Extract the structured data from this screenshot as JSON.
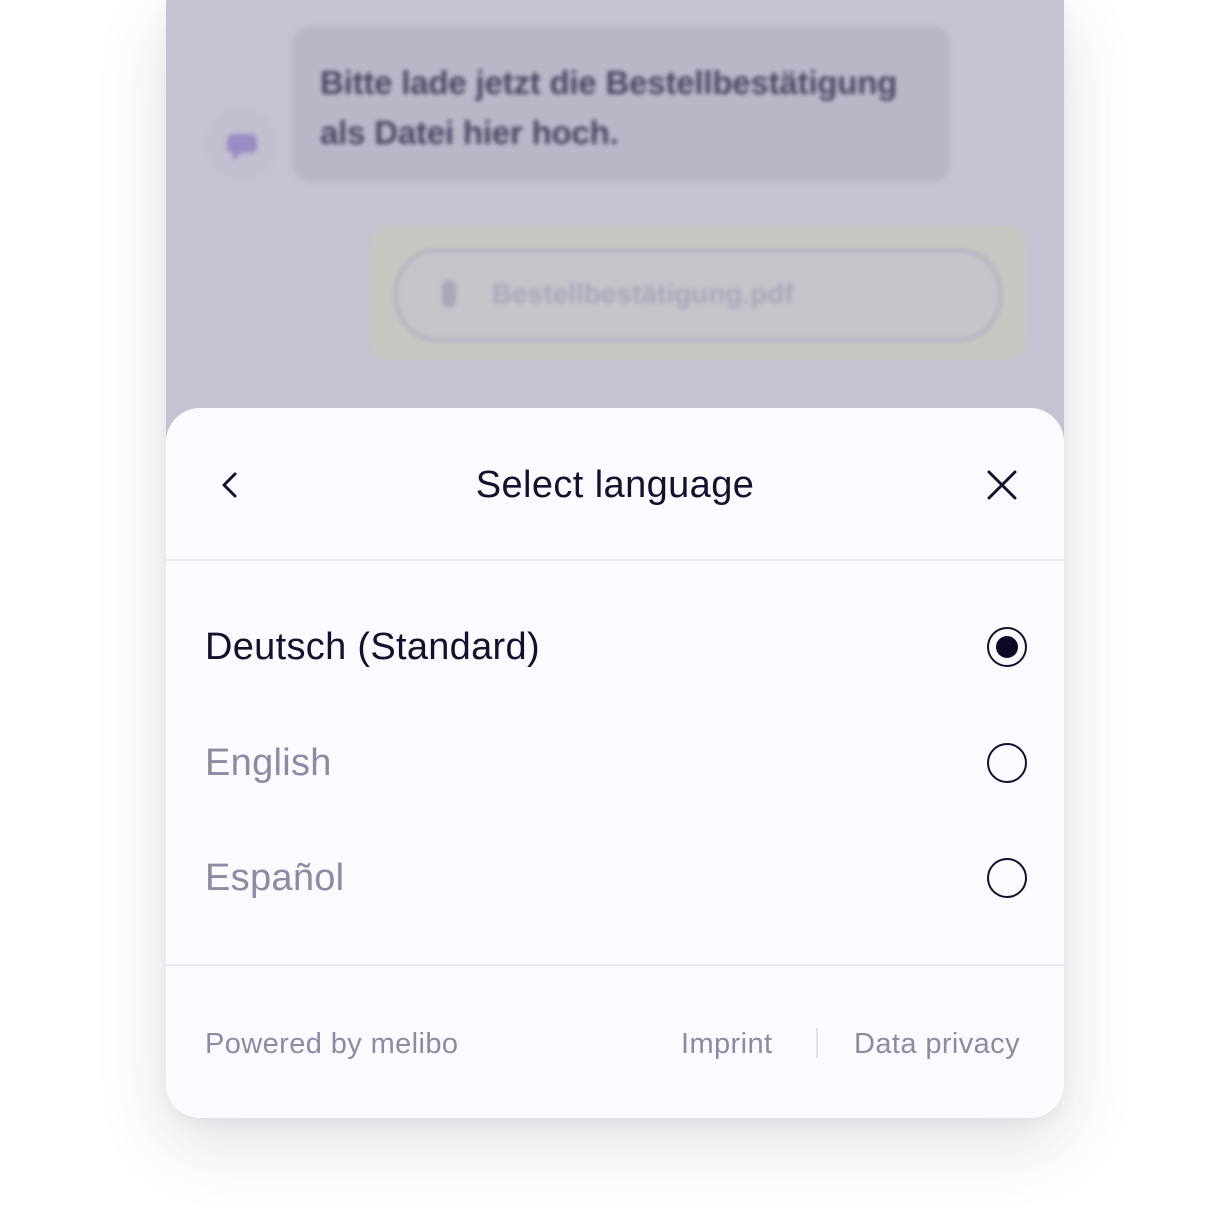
{
  "chat": {
    "bot_message": "Bitte lade jetzt die Bestellbestätigung als Datei hier hoch.",
    "uploaded_file": "Bestellbestätigung.pdf"
  },
  "language_sheet": {
    "title": "Select language",
    "options": [
      {
        "label": "Deutsch (Standard)",
        "selected": true
      },
      {
        "label": "English",
        "selected": false
      },
      {
        "label": "Español",
        "selected": false
      }
    ]
  },
  "footer": {
    "powered_by": "Powered by melibo",
    "imprint": "Imprint",
    "data_privacy": "Data privacy"
  },
  "colors": {
    "text_primary": "#13112b",
    "text_muted": "#8d8aa1",
    "sheet_background": "#fbfaff",
    "backdrop": "#c5c3d1"
  },
  "icons": {
    "back": "chevron-left-icon",
    "close": "close-icon",
    "bot": "chat-bubble-icon",
    "attachment": "paperclip-icon"
  }
}
